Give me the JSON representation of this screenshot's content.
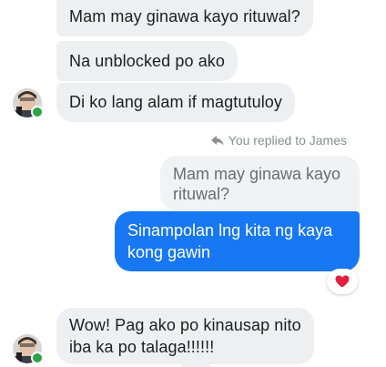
{
  "messages": {
    "m1": "Mam may ginawa kayo rituwal?",
    "m2": "Na unblocked po ako",
    "m3": "Di ko lang alam if magtutuloy",
    "replied_label": "You replied to James",
    "quoted_line1": "Mam may ginawa kayo",
    "quoted_line2": "rituwal?",
    "sent_line1": "Sinampolan lng kita ng kaya",
    "sent_line2": "kong gawin",
    "reaction": "heart",
    "m4_line1": "Wow! Pag ako po kinausap nito",
    "m4_line2": "iba ka po talaga!!!!!!"
  },
  "colors": {
    "sent_bubble": "#1877f2",
    "received_bubble": "#eeeff1",
    "online_dot": "#31a24c",
    "heart": "#e41e3f"
  },
  "icons": {
    "reply": "reply-arrow-icon",
    "reaction": "heart-icon",
    "avatar": "contact-avatar"
  }
}
